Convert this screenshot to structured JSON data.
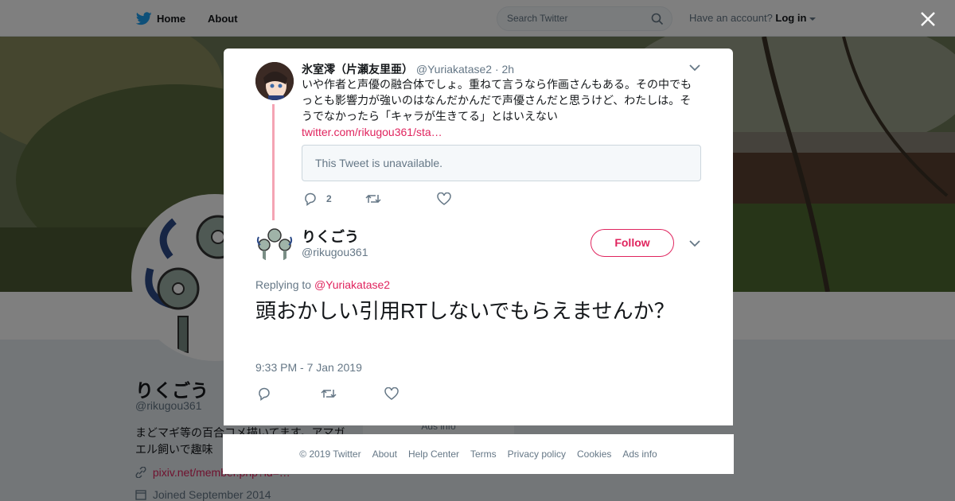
{
  "topbar": {
    "home_label": "Home",
    "about_label": "About",
    "search_placeholder": "Search Twitter",
    "account_text": "Have an account?",
    "login_label": "Log in"
  },
  "profile": {
    "name": "りくごう",
    "handle": "@rikugou361",
    "bio": "まどマギ等の百合コメ描いてます。アマガエル飼いで趣味",
    "link": "pixiv.net/member.php?id=…",
    "joined": "Joined September 2014",
    "ads_info": "Ads info"
  },
  "quoted_tweet": {
    "name": "氷室澪（片瀬友里亜）",
    "handle": "@Yuriakatase2",
    "time": "· 2h",
    "text": "いや作者と声優の融合体でしょ。重ねて言うなら作画さんもある。その中でもっとも影響力が強いのはなんだかんだで声優さんだと思うけど、わたしは。そうでなかったら「キャラが生きてる」とはいえない",
    "link": "twitter.com/rikugou361/sta…",
    "unavailable": "This Tweet is unavailable.",
    "reply_count": "2"
  },
  "main_tweet": {
    "name": "りくごう",
    "handle": "@rikugou361",
    "follow_label": "Follow",
    "replying_prefix": "Replying to",
    "replying_to": "@Yuriakatase2",
    "text": "頭おかしい引用RTしないでもらえませんか？",
    "timestamp": "9:33 PM - 7 Jan 2019"
  },
  "footer": {
    "items": [
      "© 2019 Twitter",
      "About",
      "Help Center",
      "Terms",
      "Privacy policy",
      "Cookies",
      "Ads info"
    ]
  },
  "colors": {
    "accent": "#e0245e",
    "twitter_blue": "#1da1f2",
    "thread_line": "#f4a4b4",
    "secondary_text": "#657786"
  }
}
